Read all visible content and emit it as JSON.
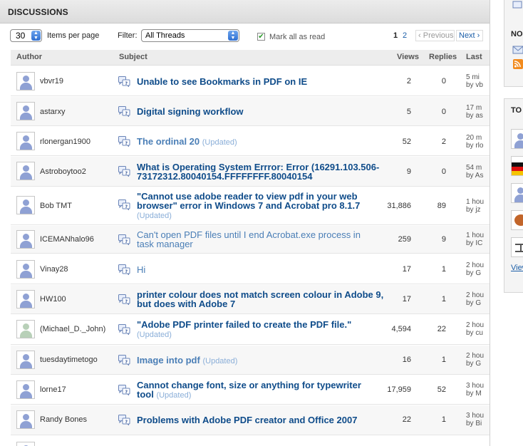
{
  "header": {
    "title": "DISCUSSIONS"
  },
  "controls": {
    "items_per_page": "30",
    "items_per_page_label": "Items per page",
    "filter_label": "Filter:",
    "filter_value": "All Threads",
    "mark_all_label": "Mark all as read",
    "mark_all_checked": true,
    "pages": [
      "1",
      "2"
    ],
    "current_page": "1",
    "previous_label": "Previous",
    "next_label": "Next"
  },
  "columns": {
    "author": "Author",
    "subject": "Subject",
    "views": "Views",
    "replies": "Replies",
    "last": "Last"
  },
  "threads": [
    {
      "author": "vbvr19",
      "subject": "Unable to see Bookmarks in PDF on IE",
      "updated": "",
      "views": "2",
      "replies": "0",
      "last1": "5 mi",
      "last2": "by vb"
    },
    {
      "author": "astarxy",
      "subject": "Digital signing workflow",
      "updated": "",
      "views": "5",
      "replies": "0",
      "last1": "17 m",
      "last2": "by as"
    },
    {
      "author": "rlonergan1900",
      "subject": "The ordinal 20",
      "updated": "(Updated)",
      "views": "52",
      "replies": "2",
      "last1": "20 m",
      "last2": "by rlo"
    },
    {
      "author": "Astroboytoo2",
      "subject": "What is Operating System Errror: Error (16291.103.506-73172312.80040154.FFFFFFFF.80040154",
      "updated": "",
      "views": "9",
      "replies": "0",
      "last1": "54 m",
      "last2": "by As"
    },
    {
      "author": "Bob TMT",
      "subject": "\"Cannot use adobe reader to view pdf in your web browser\" error in Windows 7 and Acrobat pro 8.1.7",
      "updated": "(Updated)",
      "views": "31,886",
      "replies": "89",
      "last1": "1 hou",
      "last2": "by jz"
    },
    {
      "author": "ICEMANhalo96",
      "subject": "Can't open PDF files until I end Acrobat.exe process in task manager",
      "updated": "",
      "views": "259",
      "replies": "9",
      "last1": "1 hou",
      "last2": "by IC"
    },
    {
      "author": "Vinay28",
      "subject": "Hi",
      "updated": "",
      "views": "17",
      "replies": "1",
      "last1": "2 hou",
      "last2": "by G"
    },
    {
      "author": "HW100",
      "subject": "printer colour does not match screen colour in Adobe 9, but does with Adobe 7",
      "updated": "",
      "views": "17",
      "replies": "1",
      "last1": "2 hou",
      "last2": "by G"
    },
    {
      "author": "(Michael_D._John)",
      "subject": "\"Adobe PDF printer failed to create the PDF file.\"",
      "updated": "(Updated)",
      "views": "4,594",
      "replies": "22",
      "last1": "2 hou",
      "last2": "by cu"
    },
    {
      "author": "tuesdaytimetogo",
      "subject": "Image into pdf",
      "updated": "(Updated)",
      "views": "16",
      "replies": "1",
      "last1": "2 hou",
      "last2": "by G"
    },
    {
      "author": "lorne17",
      "subject": "Cannot change font, size or anything for typewriter tool",
      "updated": "(Updated)",
      "views": "17,959",
      "replies": "52",
      "last1": "3 hou",
      "last2": "by M"
    },
    {
      "author": "Randy Bones",
      "subject": "Problems with Adobe PDF creator and Office 2007",
      "updated": "",
      "views": "22",
      "replies": "1",
      "last1": "3 hou",
      "last2": "by Bi"
    }
  ],
  "sidebar": {
    "section1_header": "NO",
    "section2_header": "TO",
    "view_link": "View"
  },
  "colors": {
    "link": "#0f4c8a",
    "read_link": "#4a7eb6",
    "updated": "#8aaed8",
    "header_bg": "#e4e4e4"
  },
  "icons": [
    "thread-icon",
    "user-avatar-icon",
    "envelope-icon",
    "rss-icon",
    "chevron-stepper-icon",
    "checkbox-icon"
  ]
}
